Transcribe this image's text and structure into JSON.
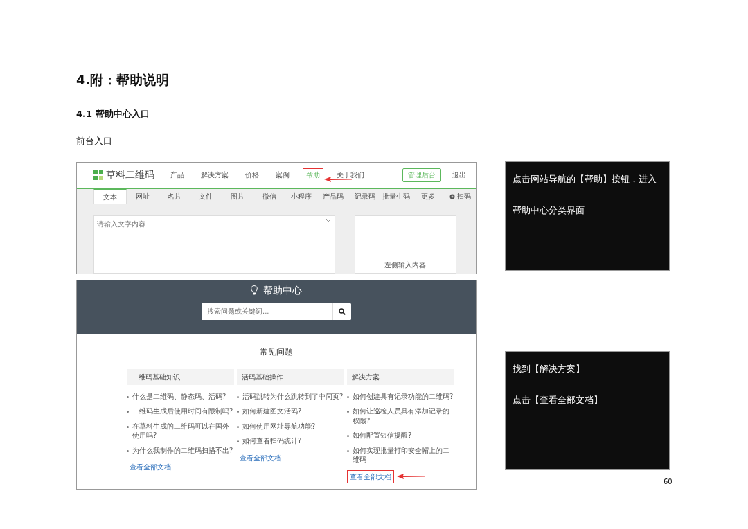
{
  "doc": {
    "heading": "4.附：帮助说明",
    "subheading": "4.1 帮助中心入口",
    "label": "前台入口",
    "page_number": "60"
  },
  "site_screenshot": {
    "brand": "草料二维码",
    "nav": [
      {
        "label": "产品",
        "highlighted": false
      },
      {
        "label": "解决方案",
        "highlighted": false
      },
      {
        "label": "价格",
        "highlighted": false
      },
      {
        "label": "案例",
        "highlighted": false
      },
      {
        "label": "帮助",
        "highlighted": true
      },
      {
        "label": "关于我们",
        "highlighted": false
      }
    ],
    "admin_button": "管理后台",
    "logout": "退出",
    "tabs": [
      {
        "label": "文本",
        "kind": "text",
        "selected": true
      },
      {
        "label": "网址",
        "kind": "text",
        "selected": false
      },
      {
        "label": "名片",
        "kind": "text",
        "selected": false
      },
      {
        "label": "文件",
        "kind": "text",
        "selected": false
      },
      {
        "label": "图片",
        "kind": "text",
        "selected": false
      },
      {
        "label": "微信",
        "kind": "text",
        "selected": false
      },
      {
        "label": "小程序",
        "kind": "text",
        "selected": false
      },
      {
        "label": "产品码",
        "kind": "text",
        "selected": false
      },
      {
        "label": "记录码",
        "kind": "text",
        "selected": false
      },
      {
        "label": "批量生码",
        "kind": "text",
        "selected": false
      },
      {
        "label": "更多",
        "kind": "text",
        "selected": false
      },
      {
        "label": "扫码",
        "kind": "scan",
        "selected": false
      }
    ],
    "editor": {
      "placeholder": "请输入文字内容"
    },
    "preview_text": "左侧输入内容"
  },
  "help_screenshot": {
    "title": "帮助中心",
    "search": {
      "placeholder": "搜索问题或关键词..."
    },
    "section_title": "常见问题",
    "columns": [
      {
        "title": "二维码基础知识",
        "questions": [
          "什么是二维码、静态码、活码?",
          "二维码生成后使用时间有限制吗?",
          "在草料生成的二维码可以在国外使用吗?",
          "为什么我制作的二维码扫描不出?"
        ],
        "link": "查看全部文档",
        "highlighted": false
      },
      {
        "title": "活码基础操作",
        "questions": [
          "活码跳转为什么跳转到了中间页?",
          "如何新建图文活码?",
          "如何使用网址导航功能?",
          "如何查看扫码统计?"
        ],
        "link": "查看全部文档",
        "highlighted": false
      },
      {
        "title": "解决方案",
        "questions": [
          "如何创建具有记录功能的二维码?",
          "如何让巡检人员具有添加记录的权限?",
          "如何配置短信提醒?",
          "如何实现批量打印安全帽上的二维码"
        ],
        "link": "查看全部文档",
        "highlighted": true
      }
    ]
  },
  "notes": [
    {
      "lines": [
        "点击网站导航的【帮助】按钮，进入",
        "帮助中心分类界面"
      ]
    },
    {
      "lines": [
        "找到【解决方案】",
        "点击【查看全部文档】"
      ]
    }
  ]
}
